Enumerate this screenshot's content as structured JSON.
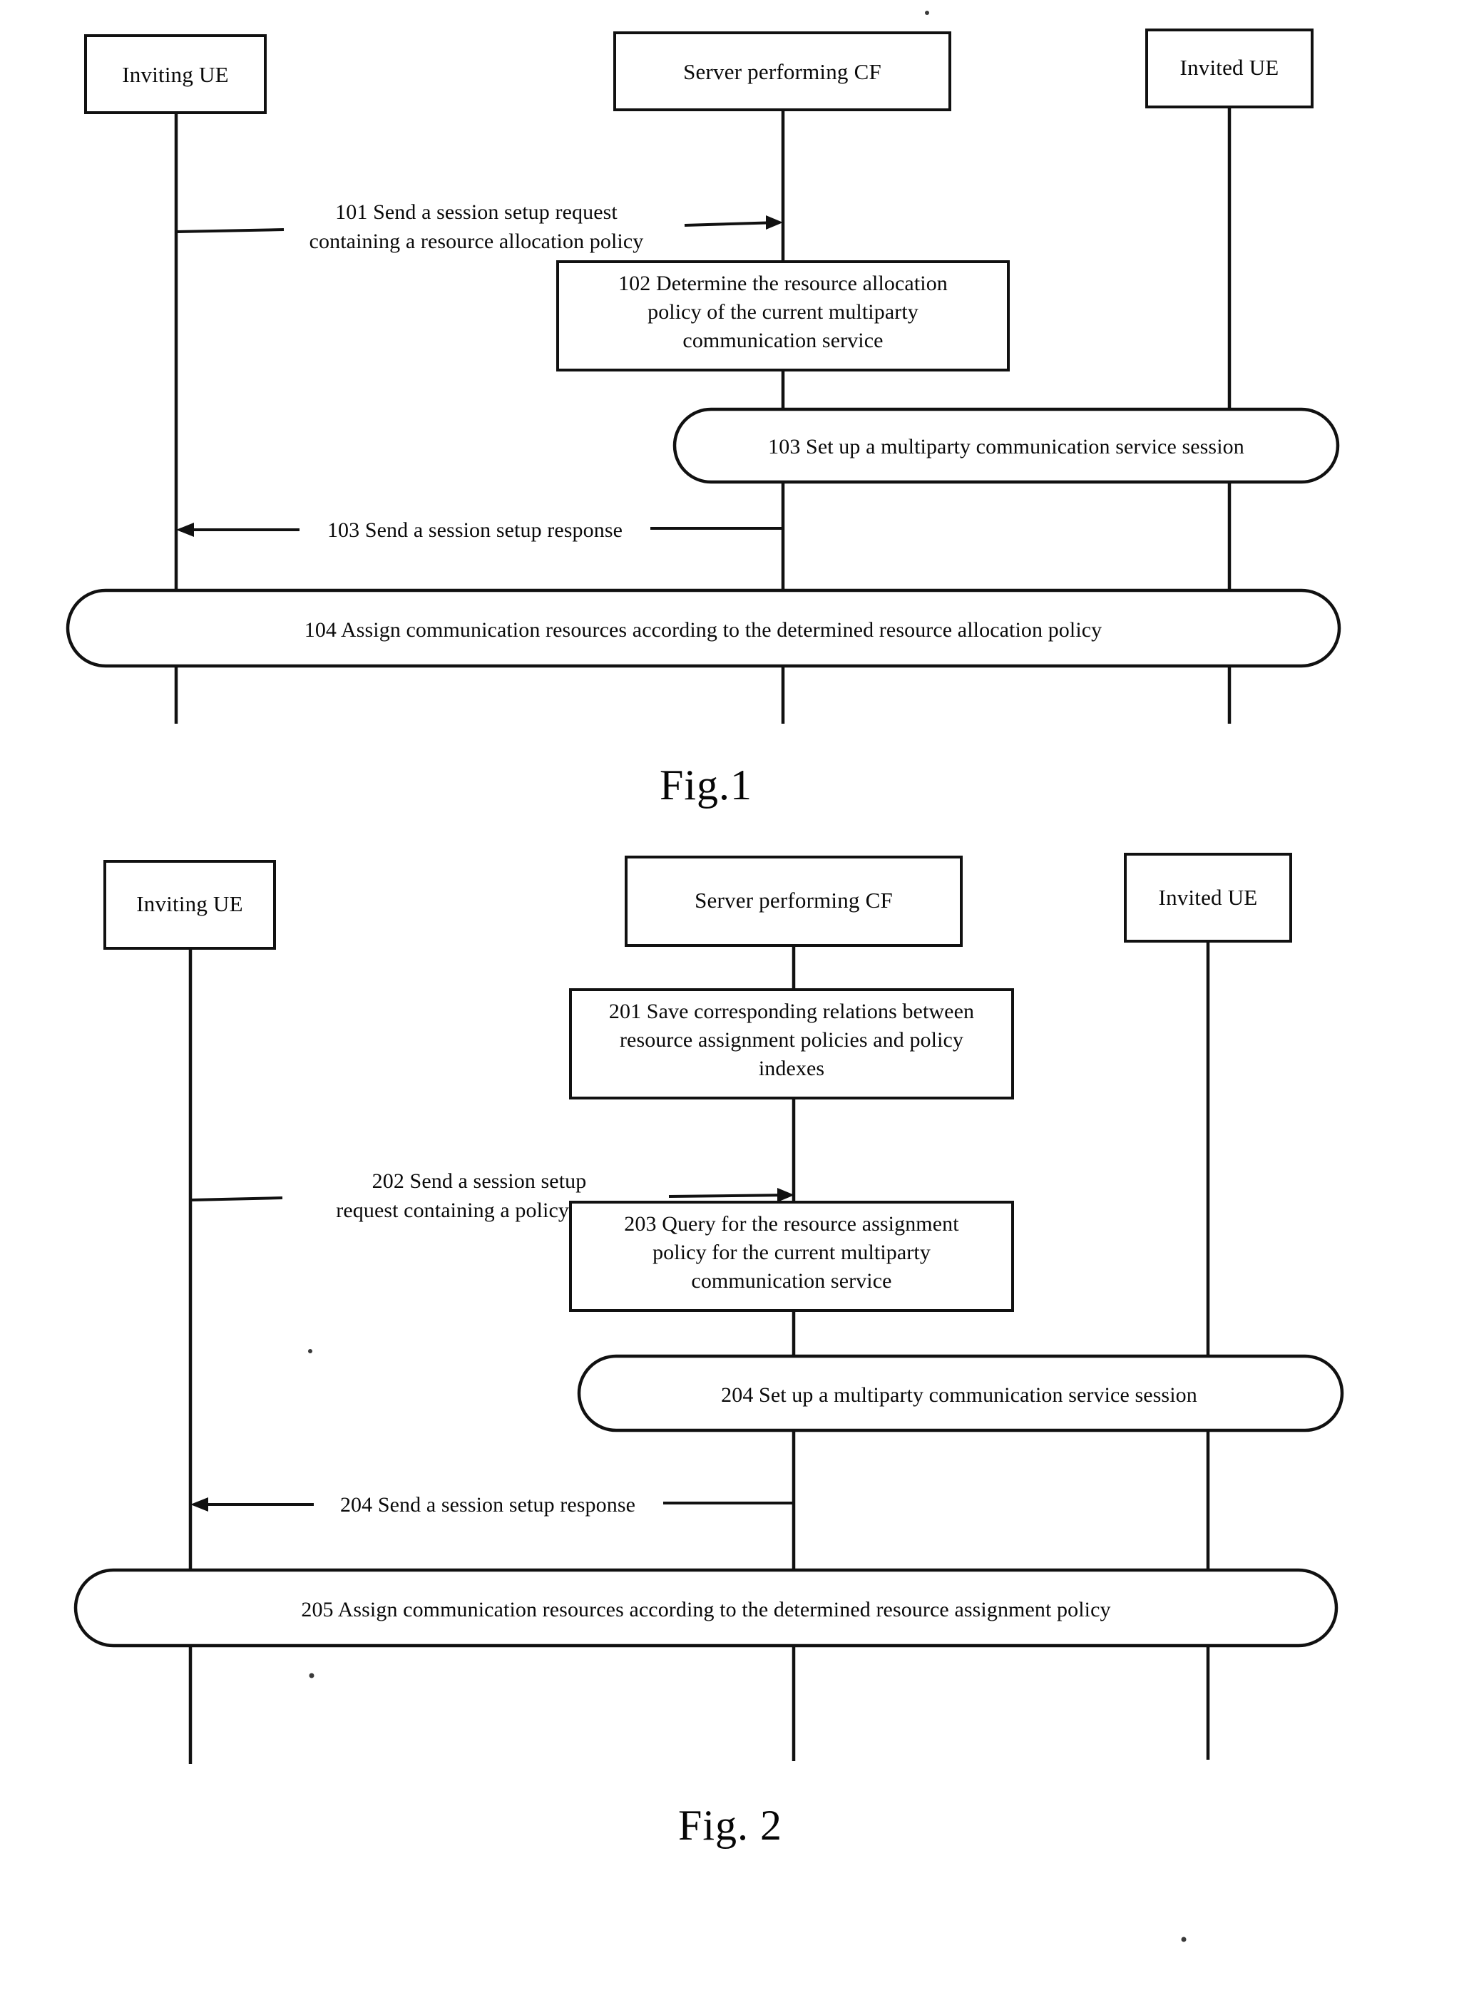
{
  "page": {
    "background_color": "#ffffff",
    "ink_color": "#111111",
    "document_type": "patent-sequence-diagram-sheet"
  },
  "figures": [
    {
      "id": "fig1",
      "caption": "Fig.1",
      "lifelines": [
        {
          "id": "inviting-ue",
          "label": "Inviting UE"
        },
        {
          "id": "server-cf",
          "label": "Server performing CF"
        },
        {
          "id": "invited-ue",
          "label": "Invited UE"
        }
      ],
      "messages": [
        {
          "id": "step-101",
          "number": "101",
          "lines": [
            "101 Send a session setup request",
            "containing a resource allocation policy"
          ],
          "from": "inviting-ue",
          "to": "server-cf",
          "direction": "right"
        },
        {
          "id": "step-103-response",
          "number": "103",
          "lines": [
            "103 Send a session setup response"
          ],
          "from": "server-cf",
          "to": "inviting-ue",
          "direction": "left"
        }
      ],
      "process_boxes": [
        {
          "id": "step-102",
          "number": "102",
          "shape": "rectangle",
          "on": "server-cf",
          "lines": [
            "102 Determine the resource allocation",
            "policy of the current multiparty",
            "communication service"
          ]
        }
      ],
      "span_boxes": [
        {
          "id": "step-103-session",
          "number": "103",
          "shape": "rounded",
          "spans": [
            "server-cf",
            "invited-ue"
          ],
          "lines": [
            "103 Set up a multiparty communication service session"
          ]
        },
        {
          "id": "step-104",
          "number": "104",
          "shape": "rounded",
          "spans": [
            "inviting-ue",
            "server-cf",
            "invited-ue"
          ],
          "lines": [
            "104 Assign communication resources according to the determined resource allocation policy"
          ]
        }
      ]
    },
    {
      "id": "fig2",
      "caption": "Fig. 2",
      "lifelines": [
        {
          "id": "inviting-ue",
          "label": "Inviting UE"
        },
        {
          "id": "server-cf",
          "label": "Server performing CF"
        },
        {
          "id": "invited-ue",
          "label": "Invited UE"
        }
      ],
      "messages": [
        {
          "id": "step-202",
          "number": "202",
          "lines": [
            "202 Send a session setup",
            "request containing a policy index"
          ],
          "from": "inviting-ue",
          "to": "server-cf",
          "direction": "right"
        },
        {
          "id": "step-204-response",
          "number": "204",
          "lines": [
            "204 Send a session setup response"
          ],
          "from": "server-cf",
          "to": "inviting-ue",
          "direction": "left"
        }
      ],
      "process_boxes": [
        {
          "id": "step-201",
          "number": "201",
          "shape": "rectangle",
          "on": "server-cf",
          "lines": [
            "201 Save corresponding relations between",
            "resource assignment policies and policy",
            "indexes"
          ]
        },
        {
          "id": "step-203",
          "number": "203",
          "shape": "rectangle",
          "on": "server-cf",
          "lines": [
            "203 Query for the resource assignment",
            "policy for the current multiparty",
            "communication service"
          ]
        }
      ],
      "span_boxes": [
        {
          "id": "step-204-session",
          "number": "204",
          "shape": "rounded",
          "spans": [
            "server-cf",
            "invited-ue"
          ],
          "lines": [
            "204 Set up a multiparty communication service session"
          ]
        },
        {
          "id": "step-205",
          "number": "205",
          "shape": "rounded",
          "spans": [
            "inviting-ue",
            "server-cf",
            "invited-ue"
          ],
          "lines": [
            "205 Assign communication resources according to the determined resource assignment policy"
          ]
        }
      ]
    }
  ]
}
